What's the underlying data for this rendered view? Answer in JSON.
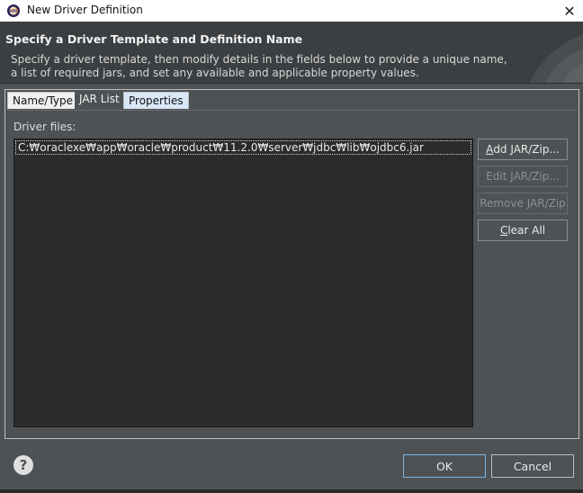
{
  "window": {
    "title": "New Driver Definition",
    "close_glyph": "✕"
  },
  "banner": {
    "title": "Specify a Driver Template and Definition Name",
    "description": "Specify a driver template, then modify details in the fields below to provide a unique name, a list of required jars, and set any available and applicable property values."
  },
  "tabs": [
    {
      "label": "Name/Type",
      "selected": false
    },
    {
      "label": "JAR List",
      "selected": true
    },
    {
      "label": "Properties",
      "selected": false
    }
  ],
  "jar_list": {
    "label": "Driver files:",
    "files": [
      "C:₩oraclexe₩app₩oracle₩product₩11.2.0₩server₩jdbc₩lib₩ojdbc6.jar"
    ],
    "buttons": {
      "add_mnemonic": "A",
      "add_rest": "dd JAR/Zip...",
      "edit": "Edit JAR/Zip...",
      "remove": "Remove JAR/Zip",
      "clear_mnemonic": "C",
      "clear_rest": "lear All"
    }
  },
  "footer": {
    "help_glyph": "?",
    "ok_label": "OK",
    "cancel_label": "Cancel"
  },
  "icons": {
    "app": "eclipse-icon",
    "close": "close-icon",
    "help": "help-icon"
  },
  "colors": {
    "dialog_bg": "#4e5254",
    "banner_bg": "#3c3f41",
    "list_bg": "#2b2b2b",
    "focus_border": "#7bb4e8"
  }
}
